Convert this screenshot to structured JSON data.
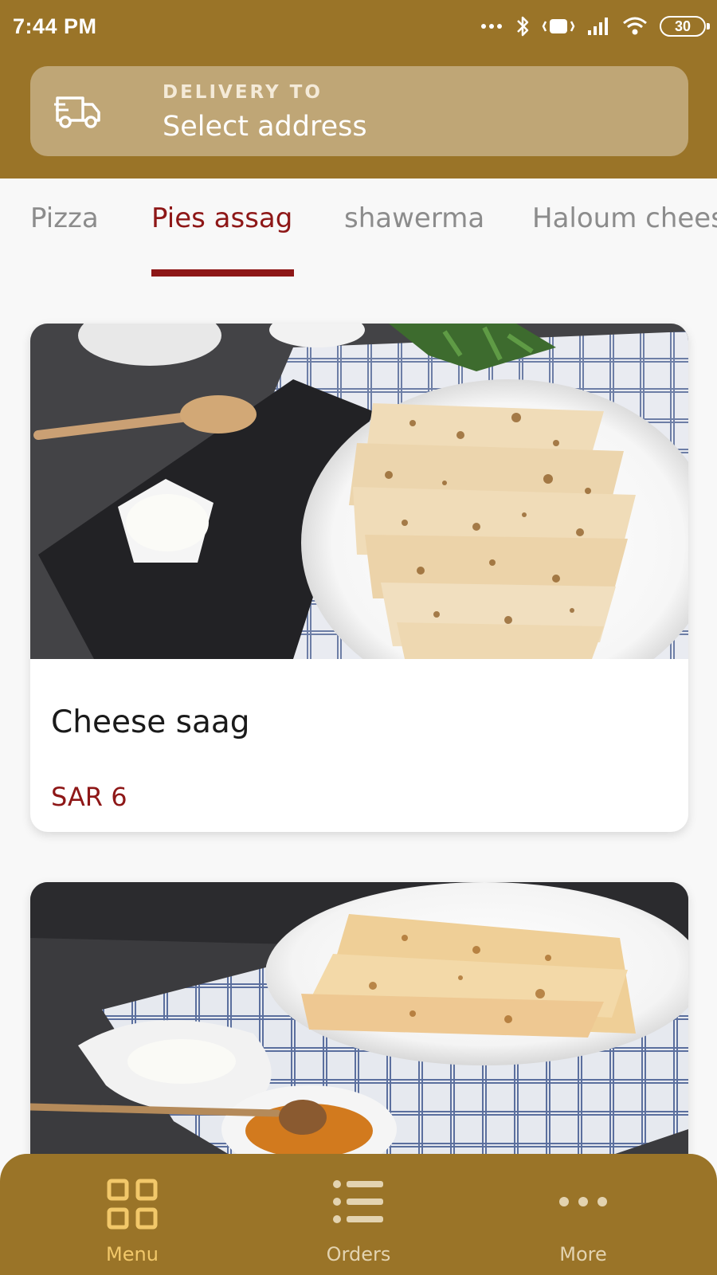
{
  "status_bar": {
    "time": "7:44 PM",
    "battery": "30"
  },
  "delivery": {
    "label": "DELIVERY TO",
    "value": "Select address"
  },
  "tabs": [
    {
      "label": "Pizza",
      "active": false
    },
    {
      "label": "Pies assag",
      "active": true
    },
    {
      "label": "shawerma",
      "active": false
    },
    {
      "label": "Haloum chees",
      "active": false
    }
  ],
  "products": [
    {
      "name": "Cheese saag",
      "price": "SAR 6",
      "image": "flatbread-plate-photo"
    },
    {
      "name": "",
      "price": "",
      "image": "flatbread-honey-photo"
    }
  ],
  "bottom_nav": [
    {
      "label": "Menu",
      "icon": "grid-icon",
      "active": true
    },
    {
      "label": "Orders",
      "icon": "list-icon",
      "active": false
    },
    {
      "label": "More",
      "icon": "more-icon",
      "active": false
    }
  ],
  "colors": {
    "brand": "#9a7428",
    "accent": "#8e1717",
    "active_nav": "#f2c86a"
  }
}
